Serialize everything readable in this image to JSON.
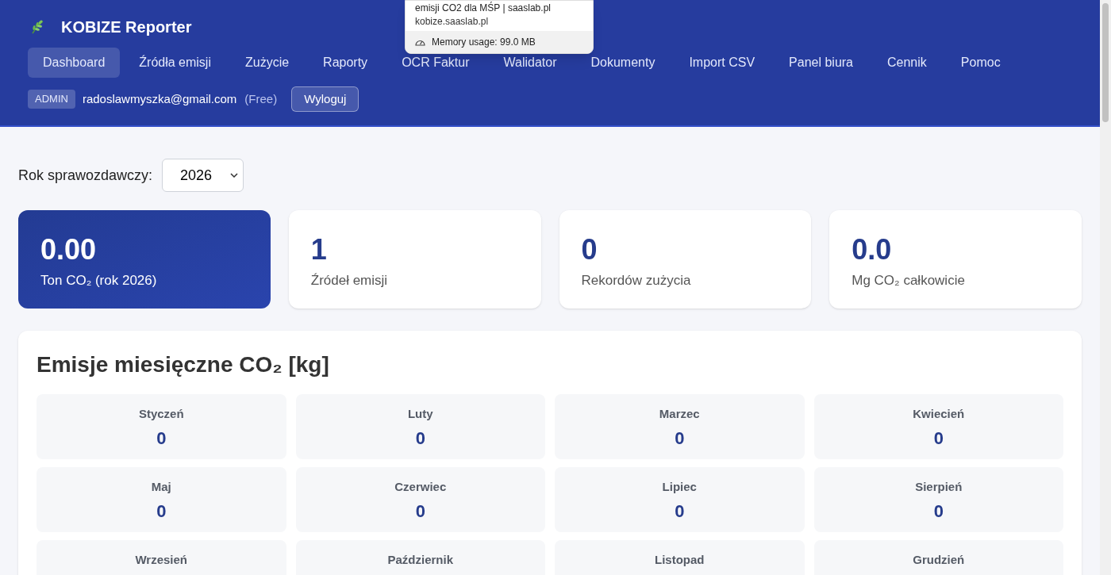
{
  "app": {
    "title": "KOBIZE Reporter"
  },
  "nav": [
    {
      "label": "Dashboard",
      "selected": true
    },
    {
      "label": "Źródła emisji",
      "selected": false
    },
    {
      "label": "Zużycie",
      "selected": false
    },
    {
      "label": "Raporty",
      "selected": false
    },
    {
      "label": "OCR Faktur",
      "selected": false
    },
    {
      "label": "Walidator",
      "selected": false
    },
    {
      "label": "Dokumenty",
      "selected": false
    },
    {
      "label": "Import CSV",
      "selected": false
    },
    {
      "label": "Panel biura",
      "selected": false
    },
    {
      "label": "Cennik",
      "selected": false
    },
    {
      "label": "Pomoc",
      "selected": false
    }
  ],
  "user": {
    "role": "ADMIN",
    "email": "radoslawmyszka@gmail.com",
    "plan": "(Free)",
    "logout": "Wyloguj"
  },
  "tab_tooltip": {
    "title": "emisji CO2 dla MŚP | saaslab.pl",
    "domain": "kobize.saaslab.pl",
    "memory": "Memory usage: 99.0 MB"
  },
  "year_picker": {
    "label": "Rok sprawozdawczy:",
    "value": "2026"
  },
  "stats": [
    {
      "value": "0.00",
      "label": "Ton CO₂ (rok 2026)",
      "highlighted": true
    },
    {
      "value": "1",
      "label": "Źródeł emisji",
      "highlighted": false
    },
    {
      "value": "0",
      "label": "Rekordów zużycia",
      "highlighted": false
    },
    {
      "value": "0.0",
      "label": "Mg CO₂ całkowicie",
      "highlighted": false
    }
  ],
  "monthly": {
    "title": "Emisje miesięczne CO₂ [kg]",
    "months": [
      {
        "name": "Styczeń",
        "value": "0"
      },
      {
        "name": "Luty",
        "value": "0"
      },
      {
        "name": "Marzec",
        "value": "0"
      },
      {
        "name": "Kwiecień",
        "value": "0"
      },
      {
        "name": "Maj",
        "value": "0"
      },
      {
        "name": "Czerwiec",
        "value": "0"
      },
      {
        "name": "Lipiec",
        "value": "0"
      },
      {
        "name": "Sierpień",
        "value": "0"
      },
      {
        "name": "Wrzesień"
      },
      {
        "name": "Październik"
      },
      {
        "name": "Listopad"
      },
      {
        "name": "Grudzień"
      }
    ]
  }
}
